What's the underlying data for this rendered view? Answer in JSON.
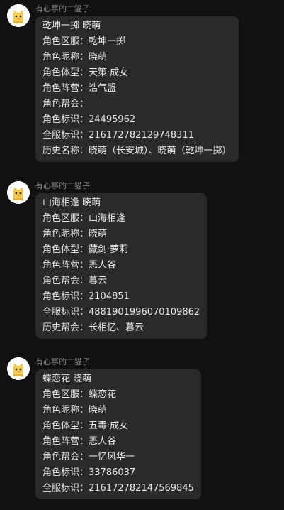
{
  "messages": [
    {
      "sender": "有心事的二猫子",
      "lines": [
        "乾坤一掷 晓萌",
        "角色区服：乾坤一掷",
        "角色昵称：晓萌",
        "角色体型：天策·成女",
        "角色阵营：浩气盟",
        "角色帮会：",
        "角色标识：24495962",
        "全服标识：216172782129748311",
        "历史名称：晓萌（长安城）、晓萌（乾坤一掷）"
      ]
    },
    {
      "sender": "有心事的二猫子",
      "lines": [
        "山海相逢 晓萌",
        "角色区服：山海相逢",
        "角色昵称：晓萌",
        "角色体型：藏剑·萝莉",
        "角色阵营：恶人谷",
        "角色帮会：暮云",
        "角色标识：2104851",
        "全服标识：4881901996070109862",
        "历史帮会：长相忆、暮云"
      ]
    },
    {
      "sender": "有心事的二猫子",
      "lines": [
        "蝶恋花 晓萌",
        "角色区服：蝶恋花",
        "角色昵称：晓萌",
        "角色体型：五毒·成女",
        "角色阵营：恶人谷",
        "角色帮会：一忆风华一",
        "角色标识：33786037",
        "全服标识：216172782147569845"
      ]
    }
  ],
  "colors": {
    "background": "#111111",
    "bubble": "#2a2a2a",
    "text": "#e8e8e8",
    "sender": "#8a8a8a",
    "avatar_cat": "#f2c94c"
  },
  "icons": {
    "avatar": "cat-avatar-icon"
  }
}
